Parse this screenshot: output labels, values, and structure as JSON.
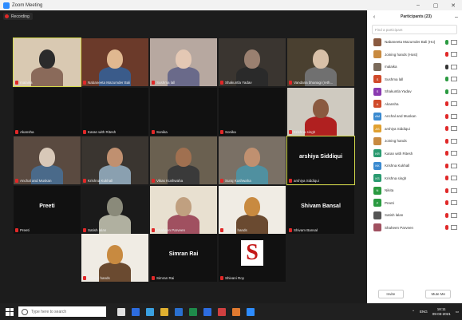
{
  "window": {
    "title": "Zoom Meeting",
    "minimize": "–",
    "restore": "▢",
    "close": "✕"
  },
  "recording": {
    "label": "Recording"
  },
  "tiles": [
    {
      "name": "malaika",
      "type": "video",
      "speaking": true,
      "colors": [
        "#d9c9b2",
        "#2b2b2b",
        "#8a6a5a"
      ]
    },
    {
      "name": "Nabaneeta Mazumder Bali",
      "type": "video",
      "colors": [
        "#6b3a2a",
        "#e0b890",
        "#3a5b8a"
      ]
    },
    {
      "name": "Sushma lall",
      "type": "video",
      "colors": [
        "#b7a8a0",
        "#e4c8b4",
        "#6a6a8a"
      ]
    },
    {
      "name": "Shakuntla Yadav",
      "type": "video",
      "colors": [
        "#3a3530",
        "#9a8070",
        "#2a2a2a"
      ]
    },
    {
      "name": "Vandana bhanagi (reth...",
      "type": "video",
      "colors": [
        "#4a4030",
        "#d8c0a8",
        "#707070"
      ]
    },
    {
      "name": "Akansha",
      "type": "blank"
    },
    {
      "name": "Karan with Ritesh",
      "type": "blank"
    },
    {
      "name": "Sonika",
      "type": "blank"
    },
    {
      "name": "Sonika",
      "type": "blank"
    },
    {
      "name": "Krishna singh",
      "type": "video",
      "colors": [
        "#cfcac0",
        "#8a5a40",
        "#b02020"
      ]
    },
    {
      "name": "Anchal and Muskan",
      "type": "video",
      "colors": [
        "#5a4a40",
        "#d8c8b8",
        "#4a6a8a"
      ]
    },
    {
      "name": "Krishna Kukhall",
      "type": "video",
      "colors": [
        "#3a3530",
        "#c09070",
        "#8aa0b0"
      ]
    },
    {
      "name": "Vikas Kushwaha",
      "type": "video",
      "colors": [
        "#6a6050",
        "#a07050",
        "#3a3a3a"
      ]
    },
    {
      "name": "Suraj Kushwaha",
      "type": "video",
      "colors": [
        "#7a7065",
        "#c09070",
        "#5090a0"
      ]
    },
    {
      "name": "arshiya Siddiqui",
      "type": "text",
      "speaking": true
    },
    {
      "name": "Preeti",
      "type": "text"
    },
    {
      "name": "Satish lalan",
      "type": "video",
      "colors": [
        "#1a1a1a",
        "#8a8a7a",
        "#b0b0a0"
      ]
    },
    {
      "name": "Shaheen Parveen",
      "type": "video",
      "colors": [
        "#e8e0d0",
        "#c0a080",
        "#a05060"
      ]
    },
    {
      "name": "Joining hands",
      "type": "video",
      "colors": [
        "#f0ece4",
        "#c88a40",
        "#6a4a30"
      ]
    },
    {
      "name": "Shivam Bansal",
      "type": "text"
    },
    {
      "name": "Joining hands",
      "type": "video",
      "colors": [
        "#f0ece4",
        "#c88a40",
        "#6a4a30"
      ]
    },
    {
      "name": "Simran Rai",
      "type": "text"
    },
    {
      "name": "Shivani Roy",
      "type": "logo",
      "letter": "S"
    }
  ],
  "participants": {
    "title": "Participants (23)",
    "search_placeholder": "Find a participant",
    "list": [
      {
        "name": "Nabaneeta Mazumder Bali (Ho)",
        "color": "#8a5a40",
        "mic": "#2a9a40"
      },
      {
        "name": "Joining hands (Host)",
        "color": "#c88a40",
        "mic": "#e02828"
      },
      {
        "name": "malaika",
        "color": "#7a6a5a",
        "mic": "#333333"
      },
      {
        "name": "Sushma lall",
        "color": "#d04a2a",
        "letter": "S",
        "mic": "#2a9a40"
      },
      {
        "name": "Shakuntla Yadav",
        "color": "#8a3ab0",
        "letter": "S",
        "mic": "#2a9a40"
      },
      {
        "name": "Akansha",
        "color": "#d04a2a",
        "letter": "A",
        "mic": "#e02828"
      },
      {
        "name": "Anchal and Muskan",
        "color": "#3a8ad0",
        "letter": "AM",
        "mic": "#e02828"
      },
      {
        "name": "arshiya Siddiqui",
        "color": "#e0a030",
        "letter": "AS",
        "mic": "#e02828"
      },
      {
        "name": "Joining hands",
        "color": "#c88a40",
        "mic": "#e02828"
      },
      {
        "name": "Karan with Ritesh",
        "color": "#2a9a70",
        "letter": "KR",
        "mic": "#e02828"
      },
      {
        "name": "Krishna Kukhall",
        "color": "#3a8ad0",
        "letter": "KK",
        "mic": "#e02828"
      },
      {
        "name": "Krishna singh",
        "color": "#2a9a70",
        "letter": "KS",
        "mic": "#e02828"
      },
      {
        "name": "Nikita",
        "color": "#2a9a40",
        "letter": "N",
        "mic": "#e02828"
      },
      {
        "name": "Preeti",
        "color": "#2a9a40",
        "letter": "P",
        "mic": "#e02828"
      },
      {
        "name": "Satish lalan",
        "color": "#555555",
        "mic": "#e02828"
      },
      {
        "name": "Shaheen Parveen",
        "color": "#a05060",
        "mic": "#e02828"
      }
    ],
    "invite_label": "Invite",
    "mute_me_label": "Mute Me"
  },
  "taskbar": {
    "search_placeholder": "Type here to search",
    "apps": [
      "#e0e0e0",
      "#2d6cdf",
      "#3aa0e0",
      "#e0b030",
      "#2a70d0",
      "#1e8a4a",
      "#2d6cdf",
      "#d04040",
      "#e07a30",
      "#2d8cff"
    ],
    "lang": "ENG",
    "time": "18:11",
    "date": "09-03-2021"
  }
}
